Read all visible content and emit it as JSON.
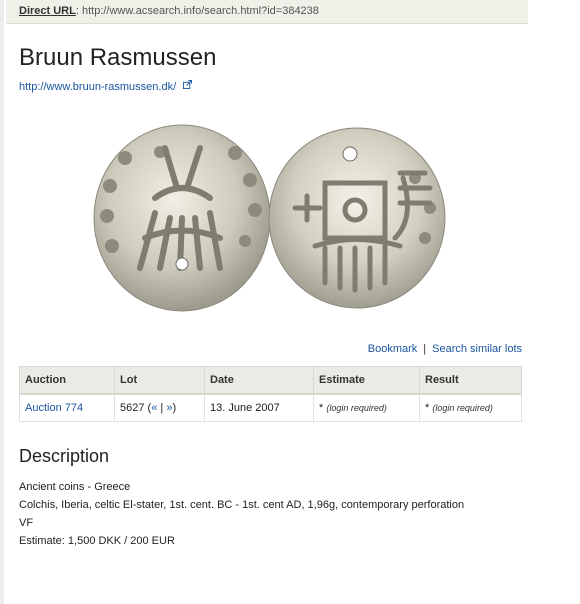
{
  "direct_url": {
    "label": "Direct URL",
    "colon": ":",
    "url": "http://www.acsearch.info/search.html?id=384238"
  },
  "auction_house": {
    "name": "Bruun Rasmussen",
    "website": "http://www.bruun-rasmussen.dk/",
    "website_icon": "external-link-icon"
  },
  "coin_image": {
    "description_visible": false
  },
  "lot_actions": {
    "bookmark_label": "Bookmark",
    "separator": "|",
    "similar_label": "Search similar lots"
  },
  "lot_table": {
    "headers": [
      "Auction",
      "Lot",
      "Date",
      "Estimate",
      "Result"
    ],
    "row": {
      "auction": "Auction 774",
      "lot": "5627",
      "lot_nav_open": "(",
      "lot_prev": "«",
      "lot_nav_sep": "|",
      "lot_next": "»",
      "lot_nav_close": ")",
      "date": "13. June 2007",
      "estimate_star": "*",
      "estimate_login": "(login required)",
      "result_star": "*",
      "result_login": "(login required)"
    }
  },
  "description": {
    "title": "Description",
    "lines": [
      "Ancient coins - Greece",
      "Colchis, Iberia, celtic El-stater, 1st. cent. BC - 1st. cent AD, 1,96g, contemporary perforation",
      "VF",
      "Estimate: 1,500 DKK / 200 EUR"
    ]
  },
  "colors": {
    "link": "#1a55a0",
    "header_bg": "#ebeae4",
    "bar_bg": "#f0efe8",
    "coin_metal": "#c8c6b8"
  }
}
